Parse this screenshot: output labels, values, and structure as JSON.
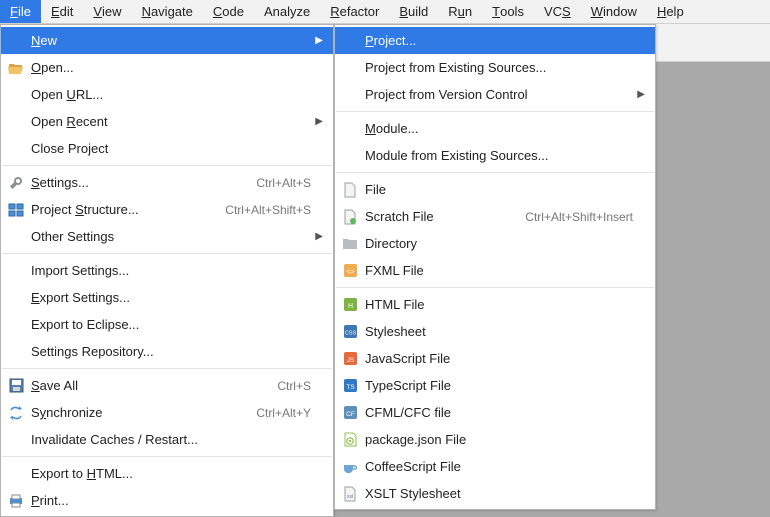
{
  "menubar": [
    {
      "label": "File",
      "mn": 0,
      "active": true
    },
    {
      "label": "Edit",
      "mn": 0
    },
    {
      "label": "View",
      "mn": 0
    },
    {
      "label": "Navigate",
      "mn": 0
    },
    {
      "label": "Code",
      "mn": 0
    },
    {
      "label": "Analyze",
      "mn": -1
    },
    {
      "label": "Refactor",
      "mn": 0
    },
    {
      "label": "Build",
      "mn": 0
    },
    {
      "label": "Run",
      "mn": 1
    },
    {
      "label": "Tools",
      "mn": 0
    },
    {
      "label": "VCS",
      "mn": 2
    },
    {
      "label": "Window",
      "mn": 0
    },
    {
      "label": "Help",
      "mn": 0
    }
  ],
  "fileMenu": [
    {
      "label": "New",
      "mn": 0,
      "submenu": true,
      "highlighted": true
    },
    {
      "label": "Open...",
      "mn": 0,
      "icon": "folder-open"
    },
    {
      "label": "Open URL...",
      "mn": 5
    },
    {
      "label": "Open Recent",
      "mn": 5,
      "submenu": true
    },
    {
      "label": "Close Project"
    },
    {
      "sep": true
    },
    {
      "label": "Settings...",
      "mn": 0,
      "icon": "wrench",
      "shortcut": "Ctrl+Alt+S"
    },
    {
      "label": "Project Structure...",
      "mn": 8,
      "icon": "structure",
      "shortcut": "Ctrl+Alt+Shift+S"
    },
    {
      "label": "Other Settings",
      "submenu": true
    },
    {
      "sep": true
    },
    {
      "label": "Import Settings..."
    },
    {
      "label": "Export Settings...",
      "mn": 0
    },
    {
      "label": "Export to Eclipse..."
    },
    {
      "label": "Settings Repository..."
    },
    {
      "sep": true
    },
    {
      "label": "Save All",
      "mn": 0,
      "icon": "save",
      "shortcut": "Ctrl+S"
    },
    {
      "label": "Synchronize",
      "mn": 1,
      "icon": "sync",
      "shortcut": "Ctrl+Alt+Y"
    },
    {
      "label": "Invalidate Caches / Restart..."
    },
    {
      "sep": true
    },
    {
      "label": "Export to HTML...",
      "mn": 10
    },
    {
      "label": "Print...",
      "mn": 0,
      "icon": "print"
    }
  ],
  "newMenu": [
    {
      "label": "Project...",
      "mn": 0,
      "highlighted": true
    },
    {
      "label": "Project from Existing Sources..."
    },
    {
      "label": "Project from Version Control",
      "submenu": true
    },
    {
      "sep": true
    },
    {
      "label": "Module...",
      "mn": 0
    },
    {
      "label": "Module from Existing Sources..."
    },
    {
      "sep": true
    },
    {
      "label": "File",
      "icon": "file"
    },
    {
      "label": "Scratch File",
      "icon": "scratch",
      "shortcut": "Ctrl+Alt+Shift+Insert"
    },
    {
      "label": "Directory",
      "icon": "folder"
    },
    {
      "label": "FXML File",
      "icon": "fxml"
    },
    {
      "sep": true
    },
    {
      "label": "HTML File",
      "icon": "html"
    },
    {
      "label": "Stylesheet",
      "icon": "css"
    },
    {
      "label": "JavaScript File",
      "icon": "js"
    },
    {
      "label": "TypeScript File",
      "icon": "ts"
    },
    {
      "label": "CFML/CFC file",
      "icon": "cf"
    },
    {
      "label": "package.json File",
      "icon": "npm"
    },
    {
      "label": "CoffeeScript File",
      "icon": "coffee"
    },
    {
      "label": "XSLT Stylesheet",
      "icon": "xslt"
    }
  ]
}
